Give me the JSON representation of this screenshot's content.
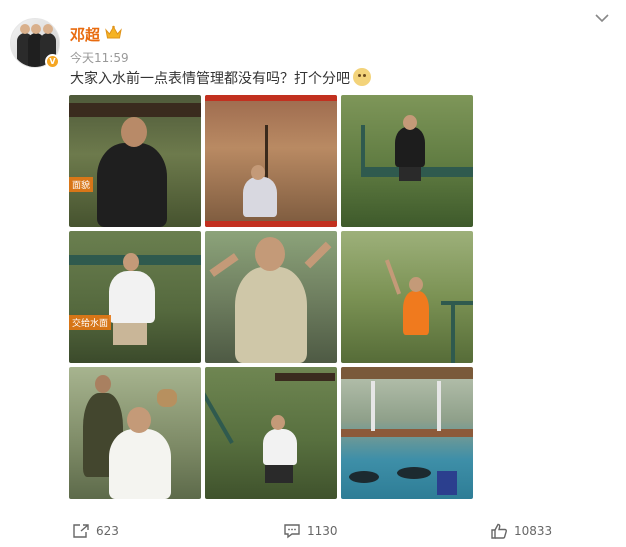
{
  "post": {
    "author": "邓超",
    "time": "今天11:59",
    "text": "大家入水前一点表情管理都没有吗？打个分吧"
  },
  "images": [
    {
      "caption": "面貌"
    },
    {
      "caption": ""
    },
    {
      "caption": ""
    },
    {
      "caption": "交给水面"
    },
    {
      "caption": ""
    },
    {
      "caption": ""
    },
    {
      "caption": ""
    },
    {
      "caption": ""
    },
    {
      "caption": ""
    }
  ],
  "actions": {
    "share_count": "623",
    "comment_count": "1130",
    "like_count": "10833"
  },
  "icons": [
    "verified-badge-icon",
    "crown-icon",
    "chevron-down-icon",
    "emoji-icon",
    "share-icon",
    "comment-icon",
    "like-icon"
  ],
  "colors": {
    "author": "#e86b0f",
    "time": "#999999",
    "text": "#333333"
  }
}
